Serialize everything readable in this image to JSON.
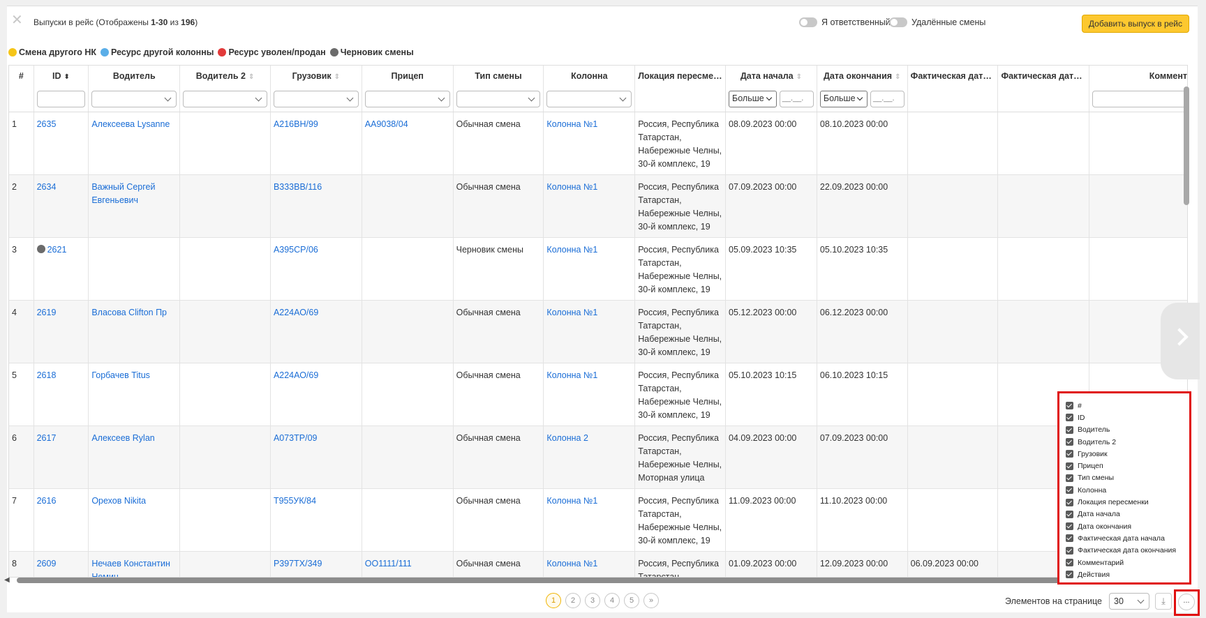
{
  "header": {
    "close_icon": "close-icon",
    "title_prefix": "Выпуски в рейс (Отображены ",
    "title_range": "1-30",
    "title_mid": " из ",
    "title_total": "196",
    "title_suffix": ")",
    "toggle_responsible": "Я ответственный",
    "toggle_deleted": "Удалённые смены",
    "add_button": "Добавить выпуск в рейс"
  },
  "legend": [
    {
      "label": "Смена другого НК",
      "color": "#f5c518"
    },
    {
      "label": "Ресурс другой колонны",
      "color": "#5aaee8"
    },
    {
      "label": "Ресурс уволен/продан",
      "color": "#e23a3a"
    },
    {
      "label": "Черновик смены",
      "color": "#6b6b6b"
    }
  ],
  "columns": [
    "#",
    "ID",
    "Водитель",
    "Водитель 2",
    "Грузовик",
    "Прицеп",
    "Тип смены",
    "Колонна",
    "Локация пересмен...",
    "Дата начала",
    "Дата окончания",
    "Фактическая дата ...",
    "Фактическая дата ...",
    "Коммент"
  ],
  "filters": {
    "date_op": "Больше",
    "date_placeholder": "__.__."
  },
  "rows": [
    {
      "n": "1",
      "id": "2635",
      "driver": "Алексеева Lysanne",
      "driver2": "",
      "truck": "А216ВН/99",
      "trailer": "АА9038/04",
      "type": "Обычная смена",
      "column": "Колонна №1",
      "location": "Россия, Республика Татарстан, Набережные Челны, 30-й комплекс, 19",
      "start": "08.09.2023 00:00",
      "end": "08.10.2023 00:00",
      "fact_start": "",
      "fact_end": "",
      "comment": ""
    },
    {
      "n": "2",
      "id": "2634",
      "driver": "Важный Сергей Евгеньевич",
      "driver2": "",
      "truck": "В333ВВ/116",
      "trailer": "",
      "type": "Обычная смена",
      "column": "Колонна №1",
      "location": "Россия, Республика Татарстан, Набережные Челны, 30-й комплекс, 19",
      "start": "07.09.2023 00:00",
      "end": "22.09.2023 00:00",
      "fact_start": "",
      "fact_end": "",
      "comment": ""
    },
    {
      "n": "3",
      "id": "2621",
      "driver": "",
      "driver2": "",
      "truck": "А395СР/06",
      "trailer": "",
      "type": "Черновик смены",
      "column": "Колонна №1",
      "location": "Россия, Республика Татарстан, Набережные Челны, 30-й комплекс, 19",
      "start": "05.09.2023 10:35",
      "end": "05.10.2023 10:35",
      "fact_start": "",
      "fact_end": "",
      "comment": ""
    },
    {
      "n": "4",
      "id": "2619",
      "driver": "Власова Clifton Пр",
      "driver2": "",
      "truck": "А224АО/69",
      "trailer": "",
      "type": "Обычная смена",
      "column": "Колонна №1",
      "location": "Россия, Республика Татарстан, Набережные Челны, 30-й комплекс, 19",
      "start": "05.12.2023 00:00",
      "end": "06.12.2023 00:00",
      "fact_start": "",
      "fact_end": "",
      "comment": ""
    },
    {
      "n": "5",
      "id": "2618",
      "driver": "Горбачев Titus",
      "driver2": "",
      "truck": "А224АО/69",
      "trailer": "",
      "type": "Обычная смена",
      "column": "Колонна №1",
      "location": "Россия, Республика Татарстан, Набережные Челны, 30-й комплекс, 19",
      "start": "05.10.2023 10:15",
      "end": "06.10.2023 10:15",
      "fact_start": "",
      "fact_end": "",
      "comment": ""
    },
    {
      "n": "6",
      "id": "2617",
      "driver": "Алексеев Rylan",
      "driver2": "",
      "truck": "А073ТР/09",
      "trailer": "",
      "type": "Обычная смена",
      "column": "Колонна 2",
      "location": "Россия, Республика Татарстан, Набережные Челны, Моторная улица",
      "start": "04.09.2023 00:00",
      "end": "07.09.2023 00:00",
      "fact_start": "",
      "fact_end": "",
      "comment": ""
    },
    {
      "n": "7",
      "id": "2616",
      "driver": "Орехов Nikita",
      "driver2": "",
      "truck": "Т955УК/84",
      "trailer": "",
      "type": "Обычная смена",
      "column": "Колонна №1",
      "location": "Россия, Республика Татарстан, Набережные Челны, 30-й комплекс, 19",
      "start": "11.09.2023 00:00",
      "end": "11.10.2023 00:00",
      "fact_start": "",
      "fact_end": "",
      "comment": ""
    },
    {
      "n": "8",
      "id": "2609",
      "driver": "Нечаев Константин Немин",
      "driver2": "",
      "truck": "Р397ТХ/349",
      "trailer": "ОО1111/111",
      "type": "Обычная смена",
      "column": "Колонна №1",
      "location": "Россия, Республика Татарстан,",
      "start": "01.09.2023 00:00",
      "end": "12.09.2023 00:00",
      "fact_start": "06.09.2023 00:00",
      "fact_end": "",
      "comment": ""
    }
  ],
  "column_menu": [
    "#",
    "ID",
    "Водитель",
    "Водитель 2",
    "Грузовик",
    "Прицеп",
    "Тип смены",
    "Колонна",
    "Локация пересменки",
    "Дата начала",
    "Дата окончания",
    "Фактическая дата начала",
    "Фактическая дата окончания",
    "Комментарий",
    "Действия"
  ],
  "pagination": {
    "pages": [
      "1",
      "2",
      "3",
      "4",
      "5"
    ],
    "current": "1",
    "next_label": "»",
    "per_page_label": "Элементов на странице",
    "per_page_value": "30",
    "more_label": "..."
  }
}
